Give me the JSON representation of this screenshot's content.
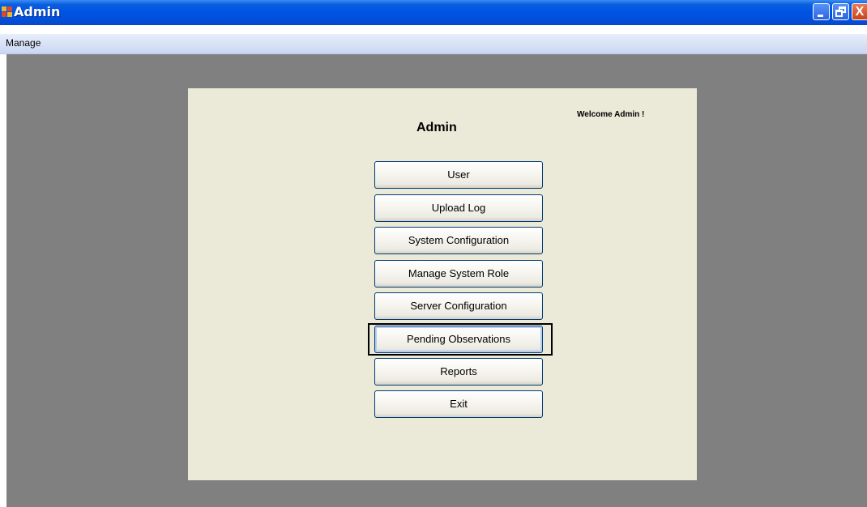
{
  "window": {
    "title": "Admin",
    "controls": {
      "minimize_icon": "minimize-icon",
      "restore_icon": "restore-icon",
      "close_icon": "close-icon",
      "close_glyph": "X"
    }
  },
  "menubar": {
    "items": [
      {
        "label": "Manage"
      }
    ]
  },
  "panel": {
    "welcome": "Welcome Admin !",
    "heading": "Admin",
    "buttons": [
      {
        "label": "User"
      },
      {
        "label": "Upload Log"
      },
      {
        "label": "System Configuration"
      },
      {
        "label": "Manage System Role"
      },
      {
        "label": "Server Configuration"
      },
      {
        "label": "Pending Observations"
      },
      {
        "label": "Reports"
      },
      {
        "label": "Exit"
      }
    ],
    "highlighted_button": "Pending Observations"
  },
  "colors": {
    "titlebar": "#0054e3",
    "workspace": "#808080",
    "panel": "#ebe9d8",
    "button_border": "#003c74",
    "highlight_frame": "#000000"
  }
}
